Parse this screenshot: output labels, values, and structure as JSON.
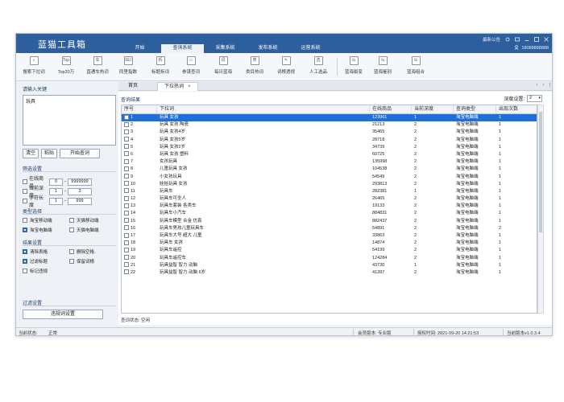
{
  "app": {
    "title": "蓝猫工具箱",
    "main_tabs": [
      "开始",
      "查询系统",
      "采集系统",
      "发布系统",
      "运营系统"
    ],
    "active_tab": 1,
    "announce": "最新公告",
    "user": "18088888888"
  },
  "toolbar": {
    "items": [
      {
        "label": "搜索下拉词",
        "icon": "search-dropdown-icon",
        "glyph": "⌕"
      },
      {
        "label": "Top20万",
        "icon": "top-icon",
        "glyph": "Top"
      },
      {
        "label": "直通车热词",
        "icon": "car-icon",
        "glyph": "车"
      },
      {
        "label": "同里指数",
        "icon": "index-icon",
        "glyph": "SEI"
      },
      {
        "label": "标题拆词",
        "icon": "split-icon",
        "glyph": "拆"
      },
      {
        "label": "参谋查词",
        "icon": "advisor-icon",
        "glyph": "▭"
      },
      {
        "label": "每日蓝海",
        "icon": "daily-icon",
        "glyph": "词"
      },
      {
        "label": "类目热词",
        "icon": "category-icon",
        "glyph": "类"
      },
      {
        "label": "词根透视",
        "icon": "root-icon",
        "glyph": "✎"
      },
      {
        "label": "人工选品",
        "icon": "manual-icon",
        "glyph": "选"
      },
      {
        "label": "蓝海裂变",
        "icon": "fission-icon",
        "glyph": "⇆"
      },
      {
        "label": "蓝海鉴别",
        "icon": "identify-icon",
        "glyph": "⇆"
      },
      {
        "label": "蓝海组合",
        "icon": "combine-icon",
        "glyph": "⇆"
      }
    ]
  },
  "left": {
    "keyword_title": "请输入关键",
    "keyword_value": "玩具",
    "clear_btn": "清空",
    "paste_btn": "粘贴",
    "start_btn": "开始查词",
    "filter_title": "筛选设置",
    "filters": [
      {
        "label": "在线商品",
        "min": "0",
        "max": "9999999"
      },
      {
        "label": "当前深度",
        "min": "1",
        "max": "3"
      },
      {
        "label": "字符长度",
        "min": "1",
        "max": "999"
      }
    ],
    "type_title": "类型选择",
    "types": [
      {
        "label": "淘宝移动端",
        "checked": false
      },
      {
        "label": "天猫移动端",
        "checked": false
      },
      {
        "label": "淘宝电脑端",
        "checked": true
      },
      {
        "label": "天猫电脑端",
        "checked": false
      }
    ],
    "result_title": "结果设置",
    "results": [
      {
        "label": "清除表格",
        "checked": true
      },
      {
        "label": "删除空格",
        "checked": false
      },
      {
        "label": "过滤标题",
        "checked": true
      },
      {
        "label": "保留词根",
        "checked": false
      },
      {
        "label": "标记违规",
        "checked": false
      }
    ],
    "filter_set_title": "过滤设置",
    "filter_set_btn": "违规词设置"
  },
  "tabs": {
    "home": "首页",
    "dropdown": "下拉热词",
    "close": "×"
  },
  "results": {
    "title": "查询结果",
    "depth_label": "深度设置:",
    "depth_value": "2",
    "columns": [
      "序号",
      "下拉词",
      "在线商品",
      "当前深度",
      "查询类型",
      "出现次数"
    ],
    "rows": [
      [
        "1",
        "玩具 女孩",
        "123961",
        "1",
        "淘宝电脑端",
        "1"
      ],
      [
        "2",
        "玩具 女孩 陶瓷",
        "21213",
        "2",
        "淘宝电脑端",
        "1"
      ],
      [
        "3",
        "玩具 女孩4岁",
        "35465",
        "2",
        "淘宝电脑端",
        "1"
      ],
      [
        "4",
        "玩具 女孩5岁",
        "28718",
        "2",
        "淘宝电脑端",
        "1"
      ],
      [
        "5",
        "玩具 女孩2岁",
        "34739",
        "2",
        "淘宝电脑端",
        "1"
      ],
      [
        "6",
        "玩具 女孩 塑料",
        "60725",
        "2",
        "淘宝电脑端",
        "1"
      ],
      [
        "7",
        "女孩玩具",
        "135998",
        "2",
        "淘宝电脑端",
        "1"
      ],
      [
        "8",
        "儿童玩具 女孩",
        "104538",
        "2",
        "淘宝电脑端",
        "1"
      ],
      [
        "9",
        "小女孩玩具",
        "54549",
        "2",
        "淘宝电脑端",
        "1"
      ],
      [
        "10",
        "娃娃玩具 女孩",
        "293813",
        "2",
        "淘宝电脑端",
        "1"
      ],
      [
        "11",
        "玩具车",
        "282381",
        "1",
        "淘宝电脑端",
        "1"
      ],
      [
        "12",
        "玩具车可坐人",
        "26465",
        "2",
        "淘宝电脑端",
        "1"
      ],
      [
        "13",
        "玩具车套装 各类车",
        "19133",
        "2",
        "淘宝电脑端",
        "1"
      ],
      [
        "14",
        "玩具车小汽车",
        "884831",
        "2",
        "淘宝电脑端",
        "1"
      ],
      [
        "15",
        "玩具车模型 合金 仿真",
        "882437",
        "2",
        "淘宝电脑端",
        "1"
      ],
      [
        "16",
        "玩具车男孩儿童玩具车",
        "54891",
        "2",
        "淘宝电脑端",
        "2"
      ],
      [
        "17",
        "玩具车大号 超大 儿童",
        "33863",
        "2",
        "淘宝电脑端",
        "1"
      ],
      [
        "18",
        "玩具车 女孩",
        "14874",
        "2",
        "淘宝电脑端",
        "1"
      ],
      [
        "19",
        "玩具车遥控",
        "54199",
        "2",
        "淘宝电脑端",
        "1"
      ],
      [
        "20",
        "玩具车遥控车",
        "124284",
        "2",
        "淘宝电脑端",
        "1"
      ],
      [
        "21",
        "玩具益智 智力 动脑",
        "43730",
        "1",
        "淘宝电脑端",
        "1"
      ],
      [
        "22",
        "玩具益智 智力 动脑 6岁",
        "41287",
        "2",
        "淘宝电脑端",
        "1"
      ]
    ],
    "query_status": "查词状态: 空闲"
  },
  "status": {
    "current_label": "当前状态:",
    "current_value": "正常",
    "member": "会员版本: 专业版",
    "auth_time": "授权时间: 2021-09-20 14:21:53",
    "version": "当前版本v1.0.3.4"
  },
  "colors": {
    "titlebar": "#2d5f9e",
    "selected_row": "#1e6fd9",
    "accent_text": "#1d3f6e"
  }
}
